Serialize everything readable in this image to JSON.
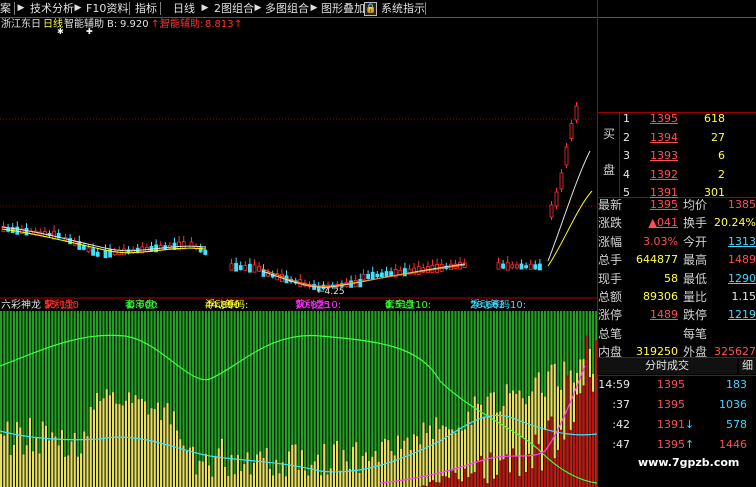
{
  "toolbar": {
    "items": [
      "案",
      "技术分析",
      "F10资料",
      "指标",
      "日线",
      "2图组合",
      "多图组合",
      "图形叠加",
      "系统指示"
    ],
    "lock_glyph": "🔒"
  },
  "info": {
    "title": "浙江东日",
    "period": "日线",
    "indicator": "智能辅助",
    "b_label": "B:",
    "b_value": "9.920",
    "b_arrow": "↑,",
    "smart_label": "智能辅助:",
    "smart_value": "8.813",
    "smart_arrow": "↑",
    "marks": [
      "✱",
      "✚"
    ]
  },
  "indicator_line": {
    "name": "六彩神龙",
    "items": [
      {
        "label": "获利盘:",
        "value": "55.110",
        "arrow": "↓",
        "color": "#ff3030"
      },
      {
        "label": "套牢盘:",
        "value": "-0.000",
        "arrow": "↓",
        "color": "#30ff30"
      },
      {
        "label": "浮动筹码:",
        "value": "44.890",
        "arrow": "↑",
        "color": "#ffff30"
      },
      {
        "label": "获利盘10:",
        "value": "70.825",
        "arrow": "↓",
        "color": "#ff30ff"
      },
      {
        "label": "套牢盘10:",
        "value": "0.513",
        "arrow": "↓",
        "color": "#30ff30"
      },
      {
        "label": "浮动筹码10:",
        "value": "28.662",
        "arrow": "↑",
        "color": "#3fd8ff"
      }
    ]
  },
  "main_chart": {
    "low_marker": "4.25",
    "colors": {
      "up": "#ff3030",
      "down": "#40e0ff",
      "ma_white": "#e0e0e0",
      "ma_yellow": "#ffff00",
      "grid": "#8b0000"
    }
  },
  "order_book": {
    "buy_label": [
      "买",
      "盘"
    ],
    "rows": [
      {
        "level": "1",
        "price": "1395",
        "vol": "618"
      },
      {
        "level": "2",
        "price": "1394",
        "vol": "27"
      },
      {
        "level": "3",
        "price": "1393",
        "vol": "6"
      },
      {
        "level": "4",
        "price": "1392",
        "vol": "2"
      },
      {
        "level": "5",
        "price": "1391",
        "vol": "301"
      }
    ]
  },
  "quote": {
    "rows": [
      {
        "l1": "最新",
        "v1": "1395",
        "l2": "均价",
        "v2": "1385"
      },
      {
        "l1": "涨跌",
        "v1": "▲041",
        "l2": "换手",
        "v2": "20.24%"
      },
      {
        "l1": "涨幅",
        "v1": "3.03%",
        "l2": "今开",
        "v2": "1313"
      },
      {
        "l1": "总手",
        "v1": "644877",
        "l2": "最高",
        "v2": "1489"
      },
      {
        "l1": "现手",
        "v1": "58",
        "l2": "最低",
        "v2": "1290"
      },
      {
        "l1": "总额",
        "v1": "89306",
        "l2": "量比",
        "v2": "1.15"
      },
      {
        "l1": "涨停",
        "v1": "1489",
        "l2": "跌停",
        "v2": "1219"
      },
      {
        "l1": "总笔",
        "v1": "",
        "l2": "每笔",
        "v2": ""
      },
      {
        "l1": "内盘",
        "v1": "319250",
        "l2": "外盘",
        "v2": "325627"
      }
    ]
  },
  "ticks": {
    "tab_label": "分时成交",
    "tab2_label": "细",
    "rows": [
      {
        "time": "14:59",
        "price": "1395",
        "arrow": "",
        "vol": "183"
      },
      {
        "time": ":37",
        "price": "1395",
        "arrow": "",
        "vol": "1036"
      },
      {
        "time": ":42",
        "price": "1391",
        "arrow": "↓",
        "vol": "578"
      },
      {
        "time": ":47",
        "price": "1395",
        "arrow": "↑",
        "vol": "1446"
      }
    ]
  },
  "watermark": "www.7gpzb.com"
}
